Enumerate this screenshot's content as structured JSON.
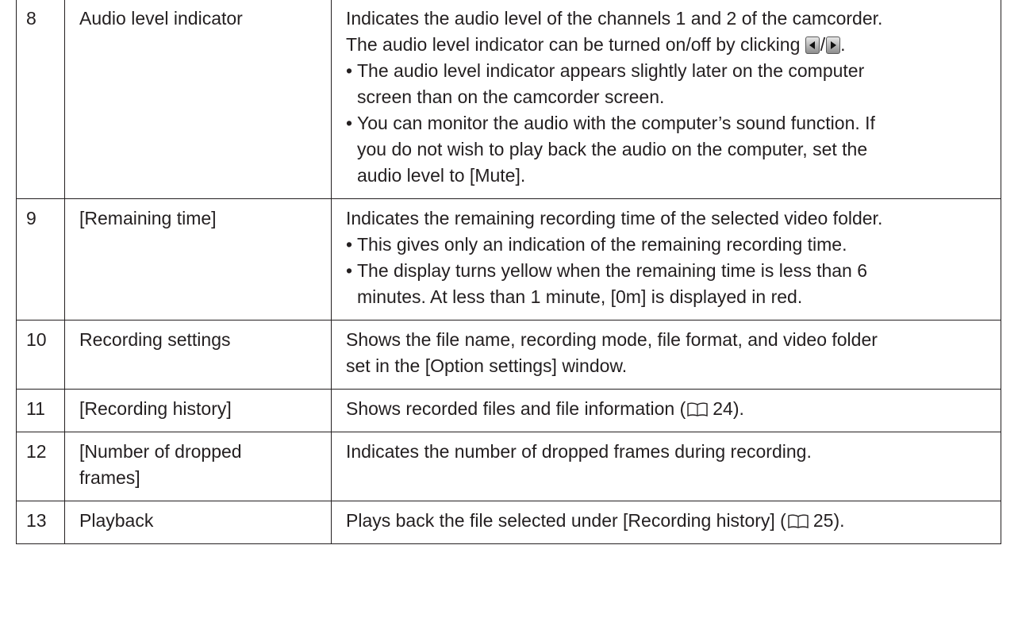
{
  "rows": [
    {
      "num": "8",
      "name": "Audio level indicator",
      "desc_line1": "Indicates the audio level of the channels 1 and 2 of the camcorder.",
      "desc_line2_pre": "The audio level indicator can be turned on/off by clicking",
      "desc_line2_sep": "/",
      "desc_line2_post": ".",
      "bullet1_a": "The audio level indicator appears slightly later on the computer",
      "bullet1_b": "screen than on the camcorder screen.",
      "bullet2_a": "You can monitor the audio with the computer’s sound function. If",
      "bullet2_b": "you do not wish to play back the audio on the computer, set the",
      "bullet2_c": "audio level to [Mute]."
    },
    {
      "num": "9",
      "name": "[Remaining time]",
      "desc_line1": "Indicates the remaining recording time of the selected video folder.",
      "bullet1_a": "This gives only an indication of the remaining recording time.",
      "bullet2_a": "The display turns yellow when the remaining time is less than 6",
      "bullet2_b": "minutes. At less than 1 minute, [0m] is displayed in red."
    },
    {
      "num": "10",
      "name": "Recording settings",
      "desc_line1": "Shows the file name, recording mode, file format, and video folder",
      "desc_line2": "set in the [Option settings] window."
    },
    {
      "num": "11",
      "name": "[Recording history]",
      "desc_pre": "Shows recorded files and file information (",
      "desc_ref": "24",
      "desc_post": ")."
    },
    {
      "num": "12",
      "name_a": "[Number of dropped",
      "name_b": "frames]",
      "desc_line1": "Indicates the number of dropped frames during recording."
    },
    {
      "num": "13",
      "name": "Playback",
      "desc_pre": "Plays back the file selected under [Recording history] (",
      "desc_ref": "25",
      "desc_post": ")."
    }
  ],
  "bullet_char": "•",
  "icons": {
    "audio_toggle_left": "arrow-left-button-icon",
    "audio_toggle_right": "arrow-right-button-icon",
    "page_reference": "book-reference-icon"
  }
}
